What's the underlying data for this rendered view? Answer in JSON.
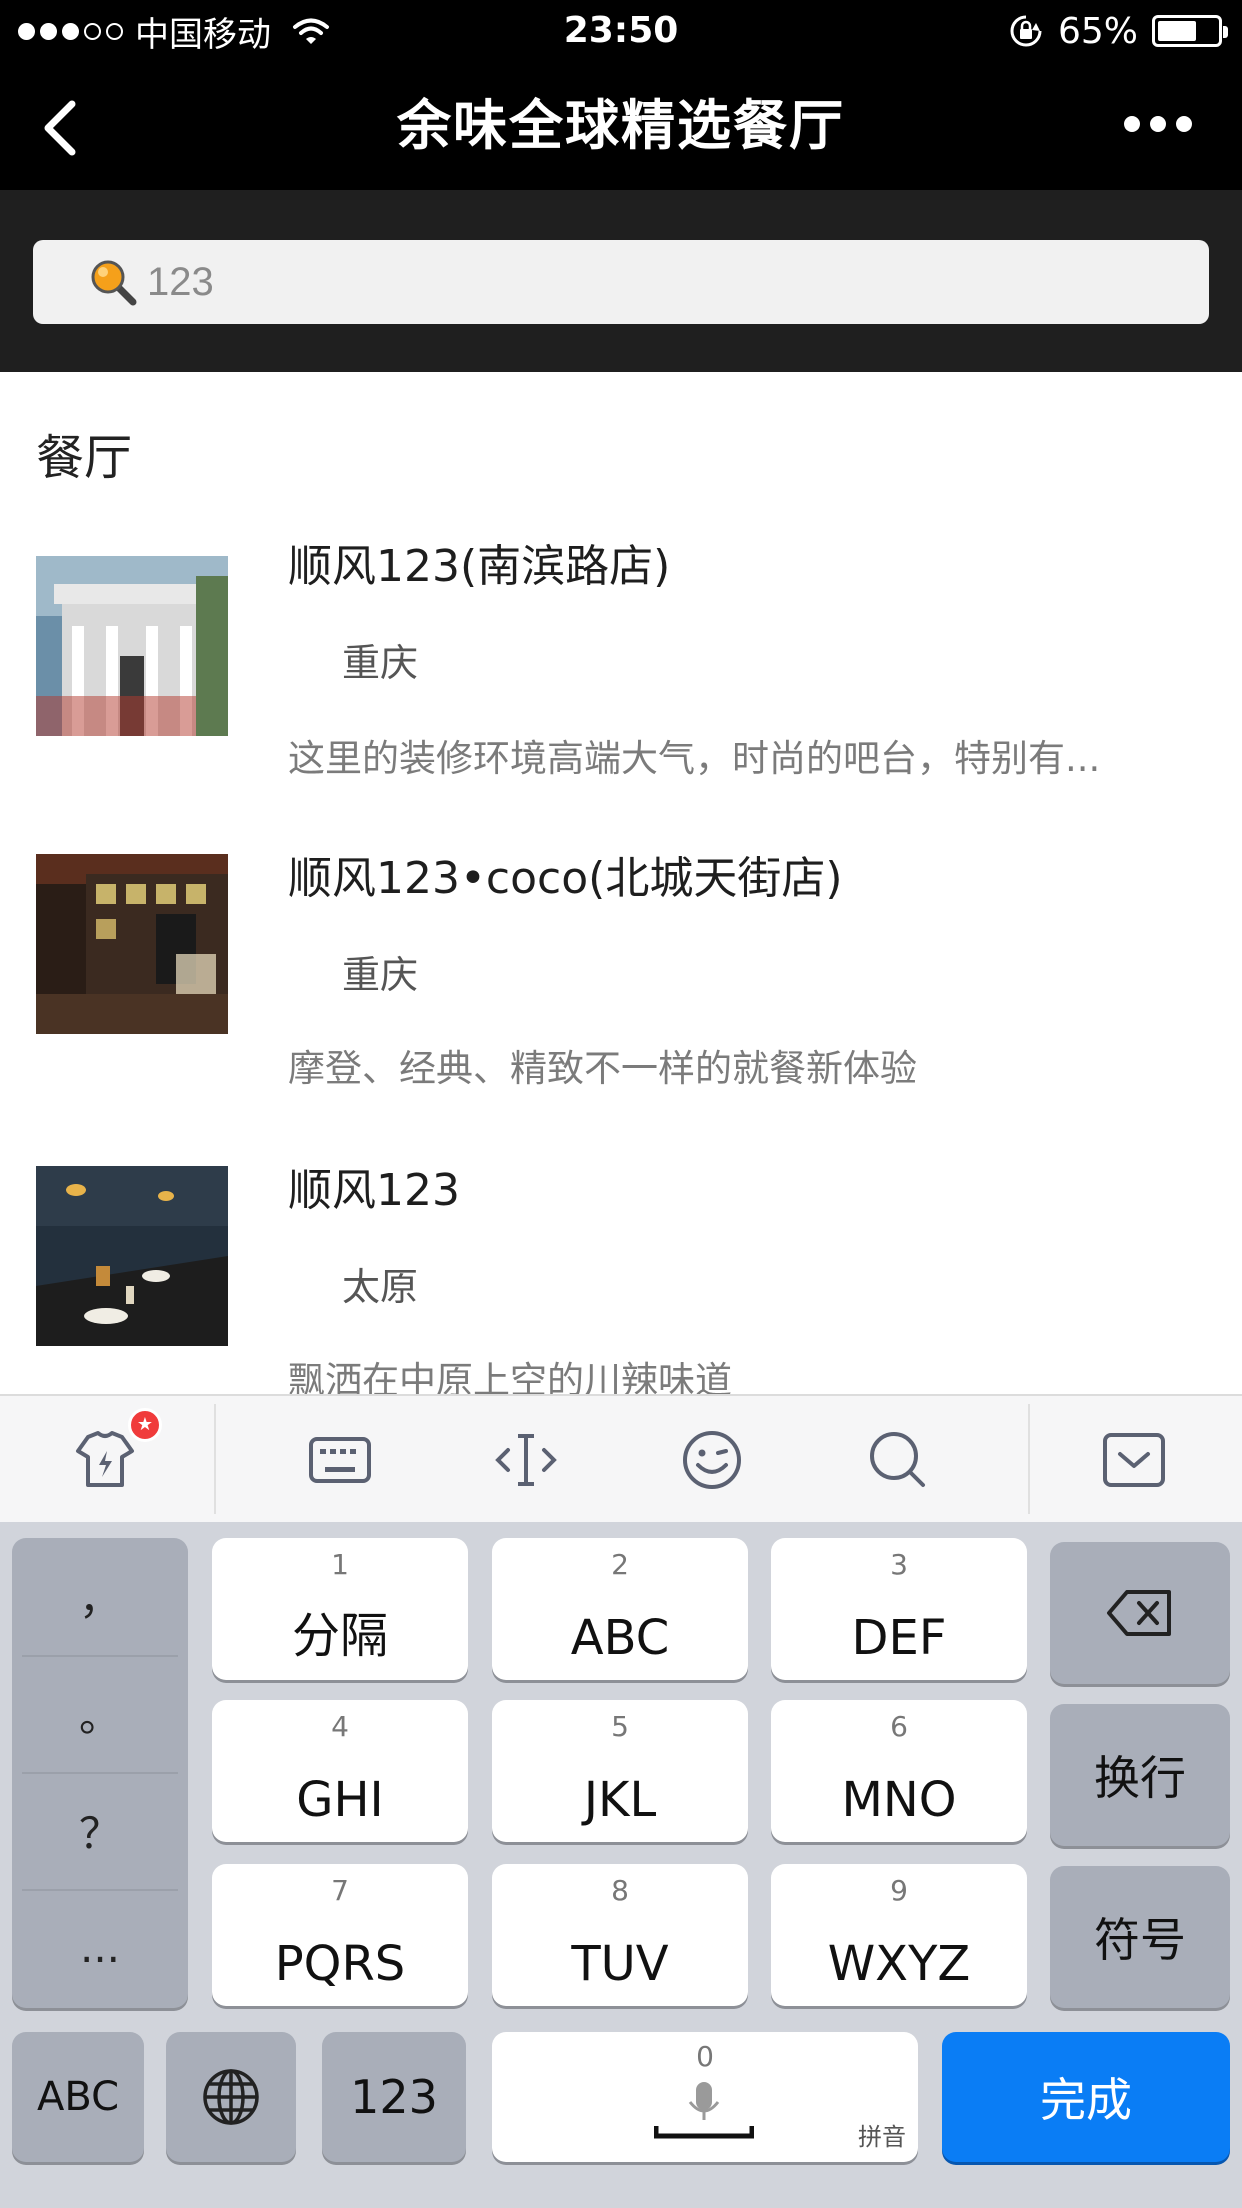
{
  "status_bar": {
    "carrier": "中国移动",
    "time": "23:50",
    "battery_percent": "65%",
    "battery_level": 0.65
  },
  "nav": {
    "title": "余味全球精选餐厅"
  },
  "search": {
    "value": "123"
  },
  "results": {
    "section_title": "餐厅",
    "items": [
      {
        "name": "顺风123(南滨路店)",
        "city": "重庆",
        "desc": "这里的装修环境高端大气，时尚的吧台，特别有..."
      },
      {
        "name": "顺风123•coco(北城天街店)",
        "city": "重庆",
        "desc": "摩登、经典、精致不一样的就餐新体验"
      },
      {
        "name": "顺风123",
        "city": "太原",
        "desc": "飘洒在中原上空的川辣味道"
      }
    ]
  },
  "keyboard": {
    "punctuation": [
      "，",
      "。",
      "？",
      "..."
    ],
    "keys": [
      {
        "num": "1",
        "label": "分隔"
      },
      {
        "num": "2",
        "label": "ABC"
      },
      {
        "num": "3",
        "label": "DEF"
      },
      {
        "num": "4",
        "label": "GHI"
      },
      {
        "num": "5",
        "label": "JKL"
      },
      {
        "num": "6",
        "label": "MNO"
      },
      {
        "num": "7",
        "label": "PQRS"
      },
      {
        "num": "8",
        "label": "TUV"
      },
      {
        "num": "9",
        "label": "WXYZ"
      }
    ],
    "newline_label": "换行",
    "symbol_label": "符号",
    "abc_label": "ABC",
    "num_label": "123",
    "space_num": "0",
    "space_hint": "拼音",
    "done_label": "完成"
  },
  "colors": {
    "done_button": "#0a7df5",
    "badge": "#f03b3b"
  },
  "icons": [
    "back-icon",
    "more-icon",
    "search-icon",
    "skin-icon",
    "keyboard-icon",
    "cursor-icon",
    "emoji-icon",
    "search-tool-icon",
    "collapse-keyboard-icon",
    "backspace-icon",
    "globe-icon",
    "microphone-icon"
  ]
}
